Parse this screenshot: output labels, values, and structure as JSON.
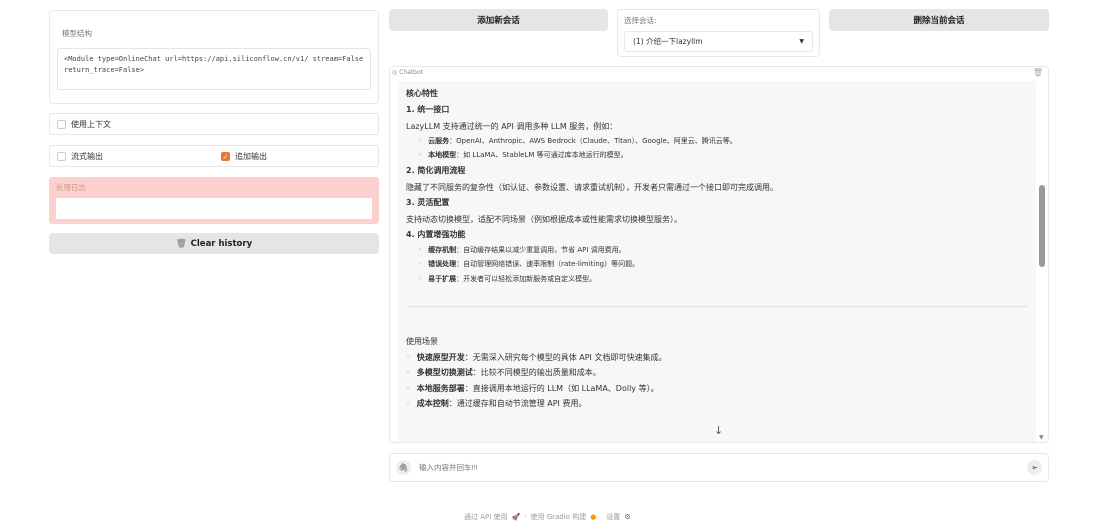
{
  "left": {
    "model_label": "模型结构",
    "model_value": "<Module type=OnlineChat url=https://api.siliconflow.cn/v1/ stream=False return_trace=False>",
    "use_context": {
      "label": "使用上下文",
      "checked": false
    },
    "stream_output": {
      "label": "流式输出",
      "checked": false
    },
    "append_output": {
      "label": "追加输出",
      "checked": true
    },
    "log_label": "处理日志",
    "log_value": "",
    "clear_label": "Clear history"
  },
  "top": {
    "add_session": "添加新会话",
    "select_label": "选择会话:",
    "select_value": "(1) 介绍一下lazyllm",
    "delete_session": "删除当前会话"
  },
  "chat": {
    "label": "Chatbot",
    "h_core": "核心特性",
    "s1": "1. 统一接口",
    "s1_text": "LazyLLM 支持通过统一的 API 调用多种 LLM 服务，例如：",
    "s1_items": [
      {
        "b": "云服务",
        "t": "：OpenAI、Anthropic、AWS Bedrock（Claude、Titan）、Google、阿里云、腾讯云等。"
      },
      {
        "b": "本地模型",
        "t": "：如 LLaMA、StableLM 等可通过库本地运行的模型。"
      }
    ],
    "s2": "2. 简化调用流程",
    "s2_text": "隐藏了不同服务的复杂性（如认证、参数设置、请求重试机制），开发者只需通过一个接口即可完成调用。",
    "s3": "3. 灵活配置",
    "s3_text": "支持动态切换模型，适配不同场景（例如根据成本或性能需求切换模型服务）。",
    "s4": "4. 内置增强功能",
    "s4_items": [
      {
        "b": "缓存机制",
        "t": "：自动缓存结果以减少重复调用，节省 API 调用费用。"
      },
      {
        "b": "错误处理",
        "t": "：自动管理网络错误、速率限制（rate-limiting）等问题。"
      },
      {
        "b": "易于扩展",
        "t": "：开发者可以轻松添加新服务或自定义模型。"
      }
    ],
    "h_use": "使用场景",
    "use_items": [
      {
        "b": "快速原型开发",
        "t": "：无需深入研究每个模型的具体 API 文档即可快速集成。"
      },
      {
        "b": "多模型切换测试",
        "t": "：比较不同模型的输出质量和成本。"
      },
      {
        "b": "本地服务部署",
        "t": "：直接调用本地运行的 LLM（如 LLaMA、Dolly 等）。"
      },
      {
        "b": "成本控制",
        "t": "：通过缓存和自动节流管理 API 费用。"
      }
    ],
    "input_placeholder": "输入内容并回车!!!"
  },
  "footer": {
    "api": "通过 API 使用",
    "sep": "·",
    "gradio": "使用 Gradio 构建",
    "settings": "设置"
  },
  "colors": {
    "accent": "#e8772e",
    "log_bg": "#fdd0d0"
  }
}
